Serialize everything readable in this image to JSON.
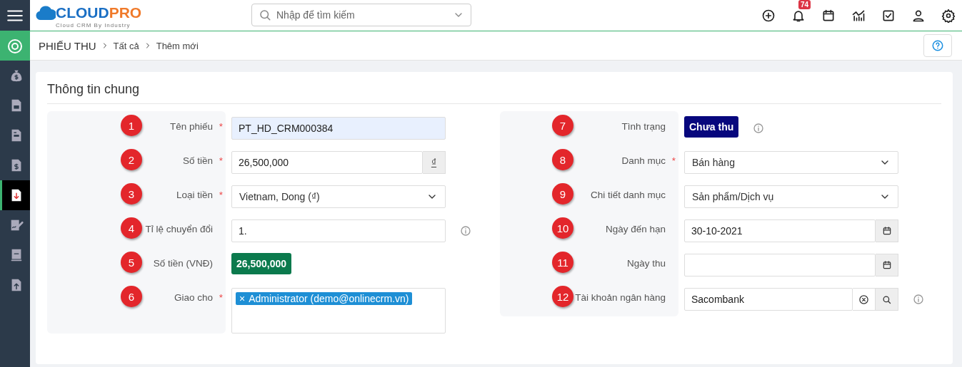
{
  "header": {
    "logo": {
      "part_1": "CLOUD",
      "part_2": "PRO",
      "tagline": "Cloud CRM By Industry"
    },
    "search": {
      "placeholder": "Nhập để tìm kiếm"
    },
    "notification_count": "74"
  },
  "sidebar": {
    "items": [
      {
        "selected": false
      },
      {
        "selected": false
      },
      {
        "selected": false
      },
      {
        "selected": false
      },
      {
        "selected": true
      },
      {
        "selected": false
      },
      {
        "selected": false
      },
      {
        "selected": false
      }
    ]
  },
  "breadcrumb": [
    "PHIẾU THU",
    "Tất cả",
    "Thêm mới"
  ],
  "section": {
    "title": "Thông tin chung"
  },
  "left_fields": [
    {
      "marker": "1",
      "label": "Tên phiếu",
      "required_mark": "*",
      "kind": "text",
      "value": "PT_HD_CRM000384",
      "highlighted": true,
      "info": false
    },
    {
      "marker": "2",
      "label": "Số tiền",
      "required_mark": "*",
      "kind": "addon",
      "value": "26,500,000",
      "addon": "₫",
      "highlighted": false,
      "info": false
    },
    {
      "marker": "3",
      "label": "Loại tiền",
      "required_mark": "*",
      "kind": "select",
      "value": "Vietnam, Dong (₫)",
      "info": false
    },
    {
      "marker": "4",
      "label": "Tỉ lệ chuyển đổi",
      "kind": "text",
      "value": "1.",
      "highlighted": false,
      "info": true
    },
    {
      "marker": "5",
      "label": "Số tiền (VNĐ)",
      "kind": "badge",
      "value": "26,500,000",
      "color": "#0b7a4d",
      "info": false
    },
    {
      "marker": "6",
      "label": "Giao cho",
      "required_mark": "*",
      "kind": "tags",
      "tags": [
        {
          "remove": "×",
          "text": "Administrator (demo@onlinecrm.vn)"
        }
      ],
      "info": false
    }
  ],
  "right_fields": [
    {
      "marker": "7",
      "label": "Tình trạng",
      "kind": "badge",
      "value": "Chưa thu",
      "color": "#07077d",
      "info": true
    },
    {
      "marker": "8",
      "label": "Danh mục",
      "required_mark": "*",
      "kind": "select",
      "value": "Bán hàng",
      "info": false
    },
    {
      "marker": "9",
      "label": "Chi tiết danh mục",
      "kind": "select",
      "value": "Sản phẩm/Dịch vụ",
      "info": false
    },
    {
      "marker": "10",
      "label": "Ngày đến hạn",
      "kind": "date",
      "value": "30-10-2021",
      "highlighted": false,
      "info": false
    },
    {
      "marker": "11",
      "label": "Ngày thu",
      "kind": "date",
      "highlighted": false,
      "info": false
    },
    {
      "marker": "12",
      "label": "Tài khoản ngân hàng",
      "kind": "lookup",
      "value": "Sacombank",
      "highlighted": false,
      "info": true
    }
  ]
}
